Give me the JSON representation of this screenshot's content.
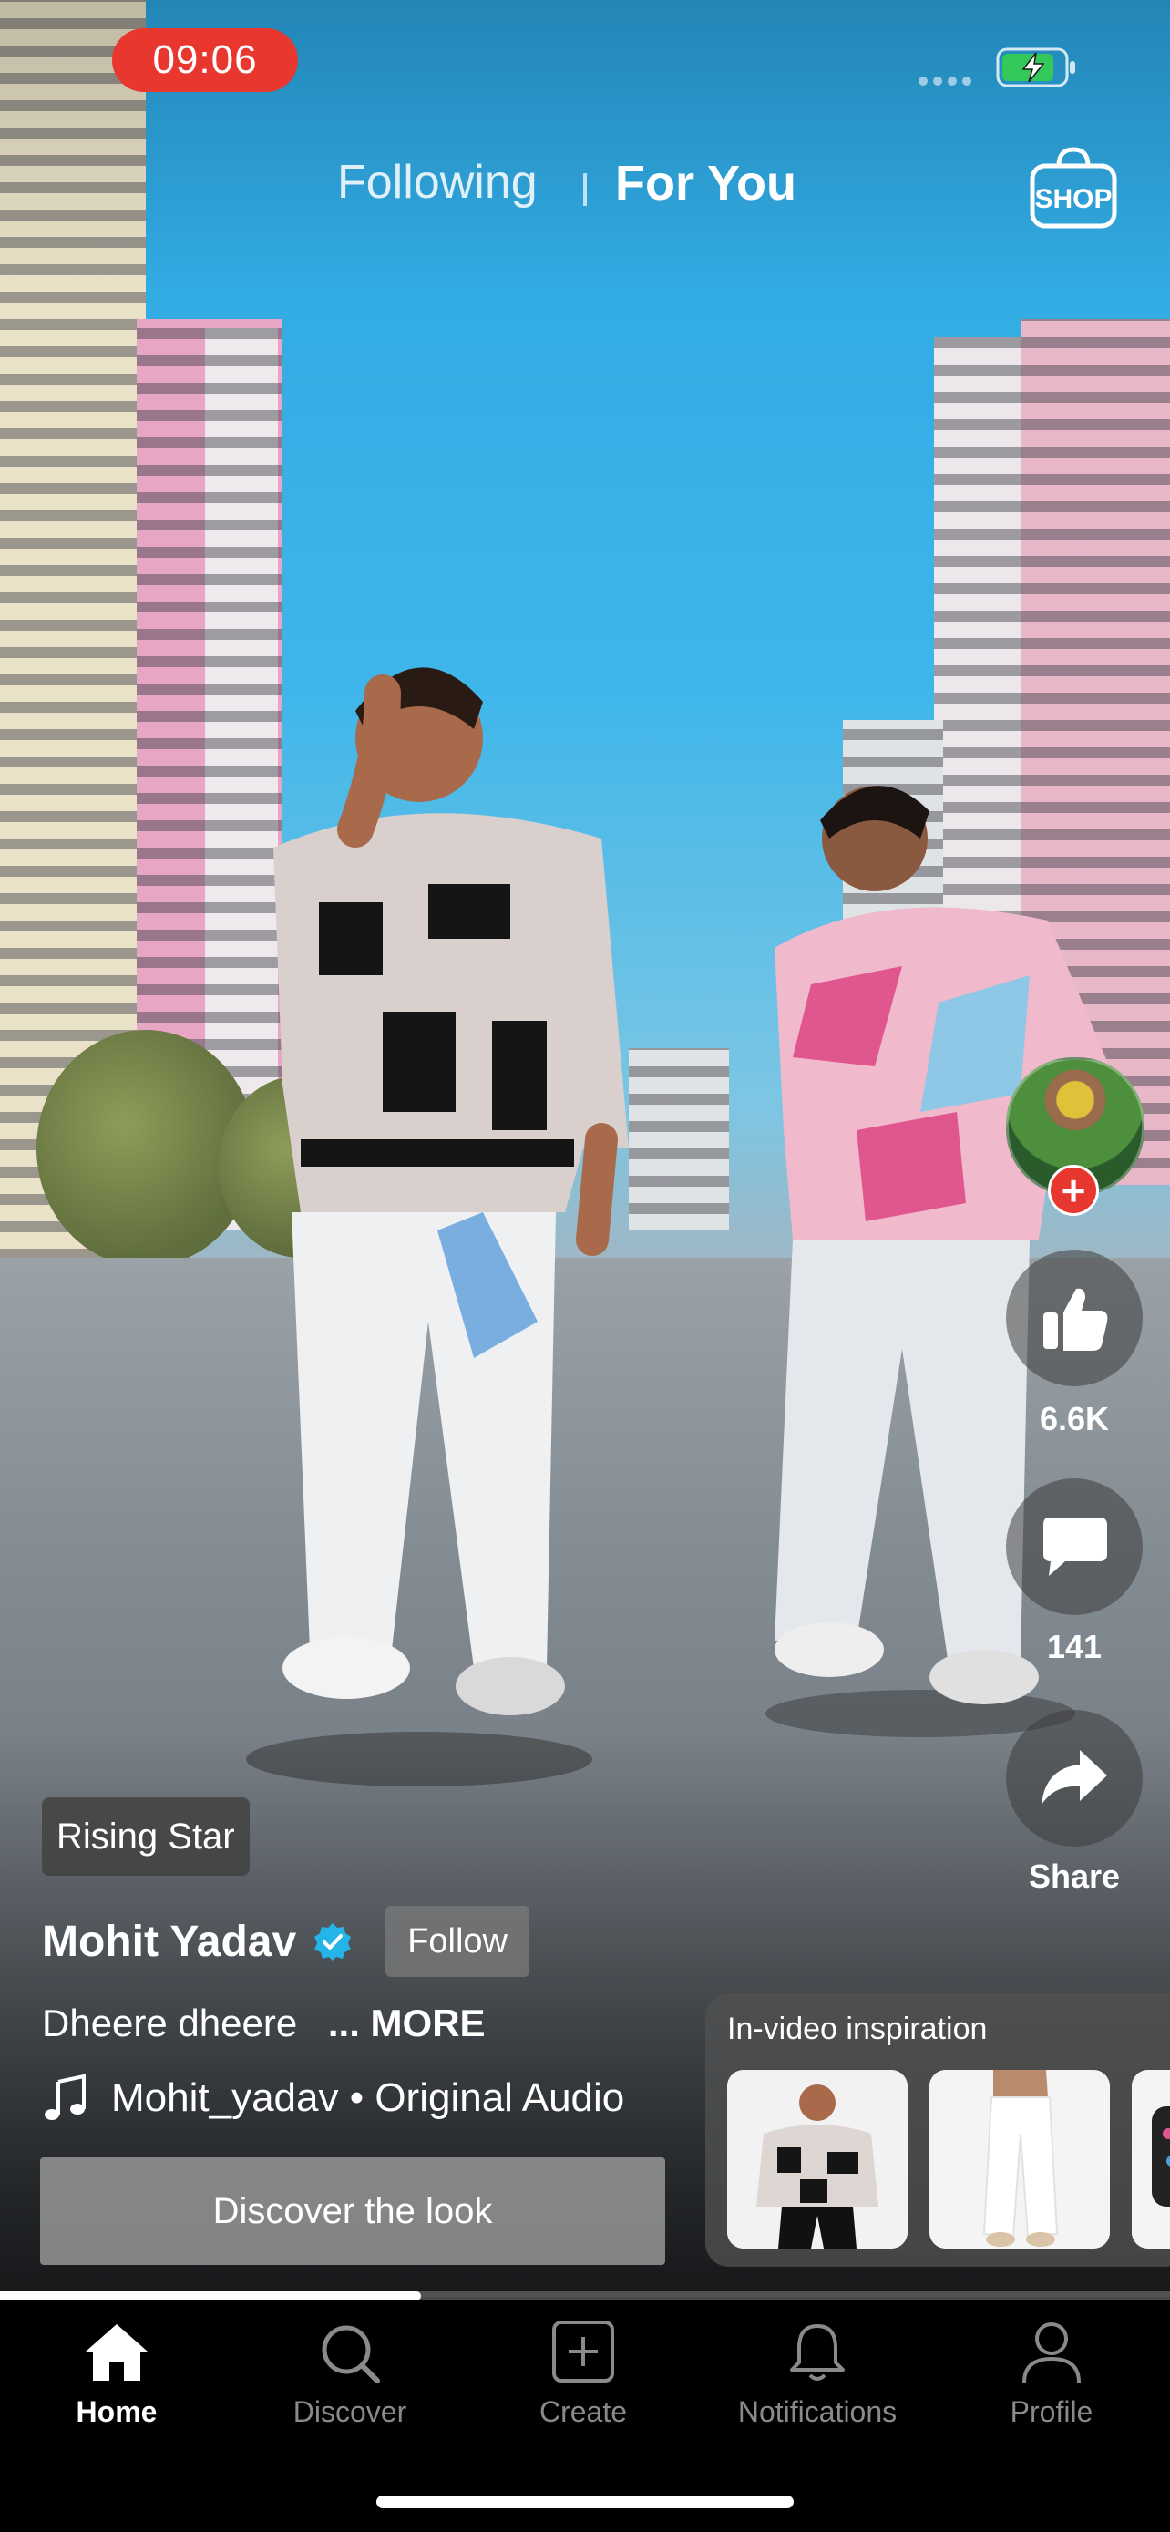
{
  "status_bar": {
    "time": "09:06",
    "battery_state": "charging",
    "battery_level": 0.85
  },
  "top_nav": {
    "tabs": [
      {
        "label": "Following",
        "active": false
      },
      {
        "label": "For You",
        "active": true
      }
    ],
    "shop_label": "SHOP"
  },
  "video": {
    "progress": 0.36
  },
  "right_rail": {
    "avatar_icon": "user-avatar",
    "follow_plus": "+",
    "like_count": "6.6K",
    "comment_count": "141",
    "share_label": "Share"
  },
  "post": {
    "badge": "Rising Star",
    "author": "Mohit Yadav",
    "verified": true,
    "follow_label": "Follow",
    "caption": "Dheere dheere",
    "more_label": "... MORE",
    "audio": "Mohit_yadav • Original Audio",
    "discover_label": "Discover the look"
  },
  "inspiration": {
    "title": "In-video inspiration"
  },
  "tab_bar": {
    "items": [
      {
        "label": "Home",
        "icon": "home-icon",
        "active": true
      },
      {
        "label": "Discover",
        "icon": "search-icon",
        "active": false
      },
      {
        "label": "Create",
        "icon": "create-icon",
        "active": false
      },
      {
        "label": "Notifications",
        "icon": "bell-icon",
        "active": false
      },
      {
        "label": "Profile",
        "icon": "profile-icon",
        "active": false
      }
    ]
  },
  "colors": {
    "accent_red": "#e8372e",
    "verified_blue": "#25b4e8",
    "battery_green": "#34c759"
  }
}
